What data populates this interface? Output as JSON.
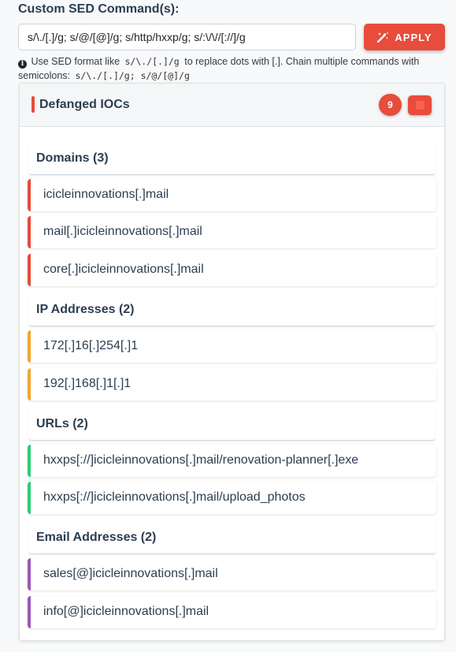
{
  "sed": {
    "label": "Custom SED Command(s):",
    "value": "s/\\./[.]/g; s/@/[@]/g; s/http/hxxp/g; s/:\\/\\//[://]/g",
    "apply_label": "APPLY",
    "hint_prefix": "Use SED format like",
    "hint_example1": "s/\\./[.]/g",
    "hint_middle": "to replace dots with [.]. Chain multiple commands with semicolons:",
    "hint_example2": "s/\\./[.]/g; s/@/[@]/g"
  },
  "panel": {
    "title": "Defanged IOCs",
    "count": "9"
  },
  "sections": {
    "domains": {
      "title": "Domains (3)",
      "items": [
        "icicleinnovations[.]mail",
        "mail[.]icicleinnovations[.]mail",
        "core[.]icicleinnovations[.]mail"
      ]
    },
    "ips": {
      "title": "IP Addresses (2)",
      "items": [
        "172[.]16[.]254[.]1",
        "192[.]168[.]1[.]1"
      ]
    },
    "urls": {
      "title": "URLs (2)",
      "items": [
        "hxxps[://]icicleinnovations[.]mail/renovation-planner[.]exe",
        "hxxps[://]icicleinnovations[.]mail/upload_photos"
      ]
    },
    "emails": {
      "title": "Email Addresses (2)",
      "items": [
        "sales[@]icicleinnovations[.]mail",
        "info[@]icicleinnovations[.]mail"
      ]
    }
  },
  "colors": {
    "accent": "#e74c3c",
    "domain": "#e74c3c",
    "ip": "#f0a830",
    "url": "#2ecc71",
    "email": "#9b59b6"
  },
  "icons": {
    "apply": "magic-wand-icon",
    "hint": "info-circle-icon",
    "stop": "stop-icon"
  }
}
